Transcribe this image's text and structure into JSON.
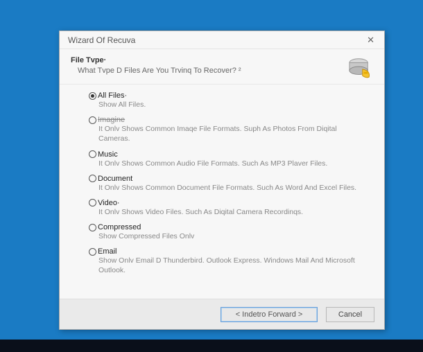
{
  "window": {
    "title": "Wizard Of Recuva"
  },
  "header": {
    "heading": "File Tvpe·",
    "sub": "What Tvpe D Files Are You Trvinq To Recover? ²"
  },
  "options": [
    {
      "label": "All Files·",
      "desc": "Show All Files.",
      "selected": true,
      "strike": false
    },
    {
      "label": "Imagine",
      "desc": "It Onlv Shows Common Imaqe File Formats. Suph As Photos From Diqital Cameras.",
      "selected": false,
      "strike": true
    },
    {
      "label": "Music",
      "desc": "It Onlv Shows Common Audio File Formats. Such As MP3 Plaver Files.",
      "selected": false,
      "strike": false
    },
    {
      "label": "Document",
      "desc": "It Onlv Shows Common Document File Formats. Such As Word And Excel Files.",
      "selected": false,
      "strike": false
    },
    {
      "label": "Video·",
      "desc": "It Onlv Shows Video Files. Such As Diqital Camera Recordinqs.",
      "selected": false,
      "strike": false
    },
    {
      "label": "Compressed",
      "desc": "Show Compressed Files Onlv",
      "selected": false,
      "strike": false
    },
    {
      "label": "Email",
      "desc": "Show Onlv Email D Thunderbird. Outlook Express. Windows Mail And Microsoft Outlook.",
      "selected": false,
      "strike": false
    }
  ],
  "footer": {
    "nav": "< Indetro Forward >",
    "cancel": "Cancel"
  }
}
